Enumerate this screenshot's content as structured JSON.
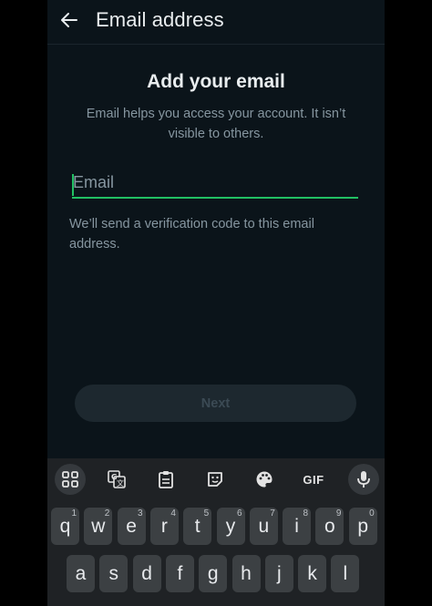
{
  "appbar": {
    "title": "Email address"
  },
  "main": {
    "heading": "Add your email",
    "subtext": "Email helps you access your account. It isn’t visible to others.",
    "email_placeholder": "Email",
    "email_value": "",
    "helper": "We’ll send a verification code to this email address.",
    "next_label": "Next"
  },
  "keyboard": {
    "toolbar": [
      {
        "name": "apps-grid-icon"
      },
      {
        "name": "translate-icon"
      },
      {
        "name": "clipboard-icon"
      },
      {
        "name": "sticker-icon"
      },
      {
        "name": "palette-icon"
      },
      {
        "name": "gif-button",
        "label": "GIF"
      },
      {
        "name": "mic-icon"
      }
    ],
    "row1": [
      {
        "key": "q",
        "hint": "1"
      },
      {
        "key": "w",
        "hint": "2"
      },
      {
        "key": "e",
        "hint": "3"
      },
      {
        "key": "r",
        "hint": "4"
      },
      {
        "key": "t",
        "hint": "5"
      },
      {
        "key": "y",
        "hint": "6"
      },
      {
        "key": "u",
        "hint": "7"
      },
      {
        "key": "i",
        "hint": "8"
      },
      {
        "key": "o",
        "hint": "9"
      },
      {
        "key": "p",
        "hint": "0"
      }
    ],
    "row2": [
      "a",
      "s",
      "d",
      "f",
      "g",
      "h",
      "j",
      "k",
      "l"
    ]
  },
  "colors": {
    "background": "#0b141a",
    "accent": "#21c063",
    "text_primary": "#e9edef",
    "text_secondary": "#8696a0",
    "keyboard_bg": "#1f2225",
    "key_bg": "#3c4043"
  }
}
